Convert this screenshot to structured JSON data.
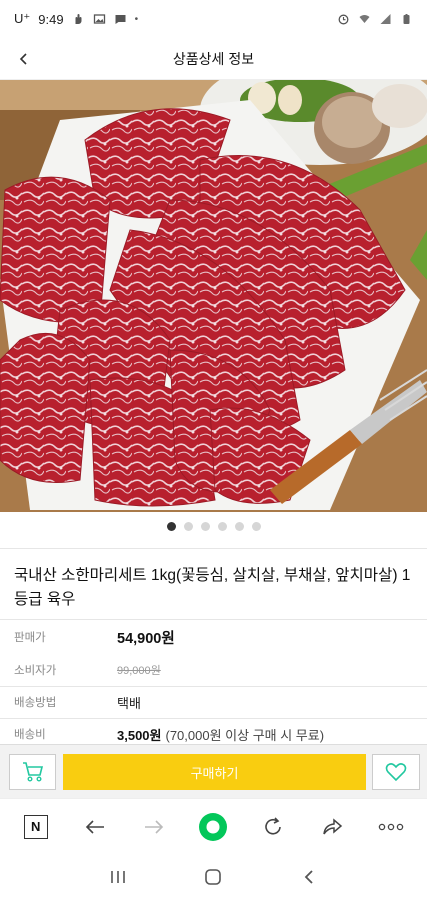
{
  "status_bar": {
    "carrier": "U⁺",
    "time": "9:49"
  },
  "header": {
    "title": "상품상세 정보"
  },
  "gallery": {
    "image_count": 6,
    "active_index": 0,
    "image_label": "product-photo-beef"
  },
  "product": {
    "name": "국내산 소한마리세트 1kg(꽃등심, 살치살, 부채살, 앞치마살) 1등급 육우",
    "rows": [
      {
        "label": "판매가",
        "value": "54,900원"
      },
      {
        "label": "소비자가",
        "value": "99,000원"
      },
      {
        "label": "배송방법",
        "value": "택배"
      },
      {
        "label": "배송비",
        "value": "3,500원",
        "note": "(70,000원 이상 구매 시 무료)"
      }
    ]
  },
  "actions": {
    "buy_label": "구매하기",
    "cart_icon": "cart-icon",
    "wish_icon": "heart-icon"
  },
  "browser": {
    "logo": "N"
  },
  "colors": {
    "accent": "#f9cd10",
    "icon_accent": "#22c8a0",
    "browser_green": "#03c75a"
  }
}
